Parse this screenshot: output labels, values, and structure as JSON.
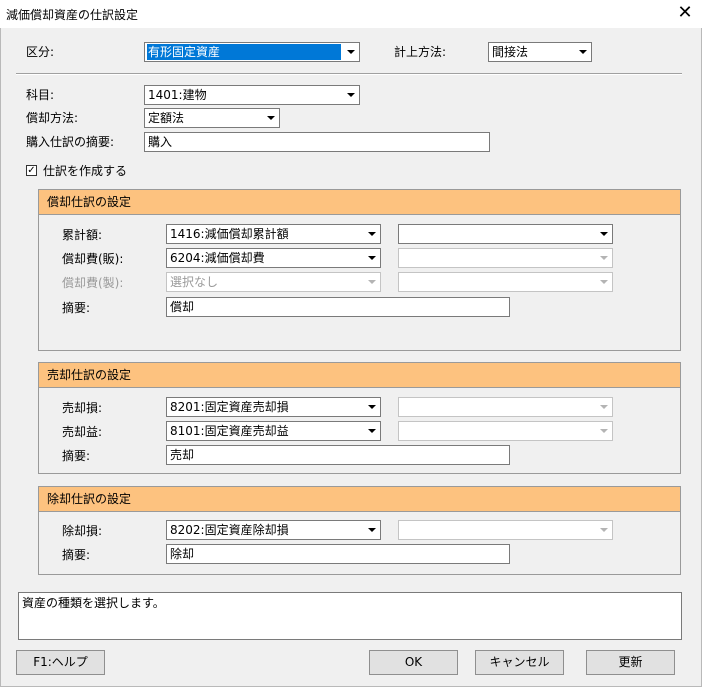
{
  "window": {
    "title": "減価償却資産の仕訳設定",
    "close": "✕"
  },
  "header": {
    "category_label": "区分:",
    "category_value": "有形固定資産",
    "method_label": "計上方法:",
    "method_value": "間接法"
  },
  "form": {
    "account_label": "科目:",
    "account_value": "1401:建物",
    "dep_method_label": "償却方法:",
    "dep_method_value": "定額法",
    "purchase_summary_label": "購入仕訳の摘要:",
    "purchase_summary_value": "購入",
    "create_journal_label": "仕訳を作成する",
    "create_journal_checked": true,
    "check_mark": "✓"
  },
  "depreciation_group": {
    "title": "償却仕訳の設定",
    "rows": [
      {
        "label": "累計額:",
        "value": "1416:減価償却累計額",
        "sub": "",
        "enabled": true,
        "sub_enabled": true
      },
      {
        "label": "償却費(販):",
        "value": "6204:減価償却費",
        "sub": "",
        "enabled": true,
        "sub_enabled": false
      },
      {
        "label": "償却費(製):",
        "value": "選択なし",
        "sub": "",
        "enabled": false,
        "sub_enabled": false
      }
    ],
    "summary_label": "摘要:",
    "summary_value": "償却"
  },
  "sale_group": {
    "title": "売却仕訳の設定",
    "rows": [
      {
        "label": "売却損:",
        "value": "8201:固定資産売却損",
        "sub": "",
        "enabled": true,
        "sub_enabled": false
      },
      {
        "label": "売却益:",
        "value": "8101:固定資産売却益",
        "sub": "",
        "enabled": true,
        "sub_enabled": false
      }
    ],
    "summary_label": "摘要:",
    "summary_value": "売却"
  },
  "disposal_group": {
    "title": "除却仕訳の設定",
    "rows": [
      {
        "label": "除却損:",
        "value": "8202:固定資産除却損",
        "sub": "",
        "enabled": true,
        "sub_enabled": false
      }
    ],
    "summary_label": "摘要:",
    "summary_value": "除却"
  },
  "message": "資産の種類を選択します。",
  "buttons": {
    "help": "F1:ヘルプ",
    "ok": "OK",
    "cancel": "キャンセル",
    "update": "更新"
  },
  "colors": {
    "group_header": "#fdc27f",
    "selection": "#0078d7",
    "dialog_bg": "#f0f0f0"
  }
}
